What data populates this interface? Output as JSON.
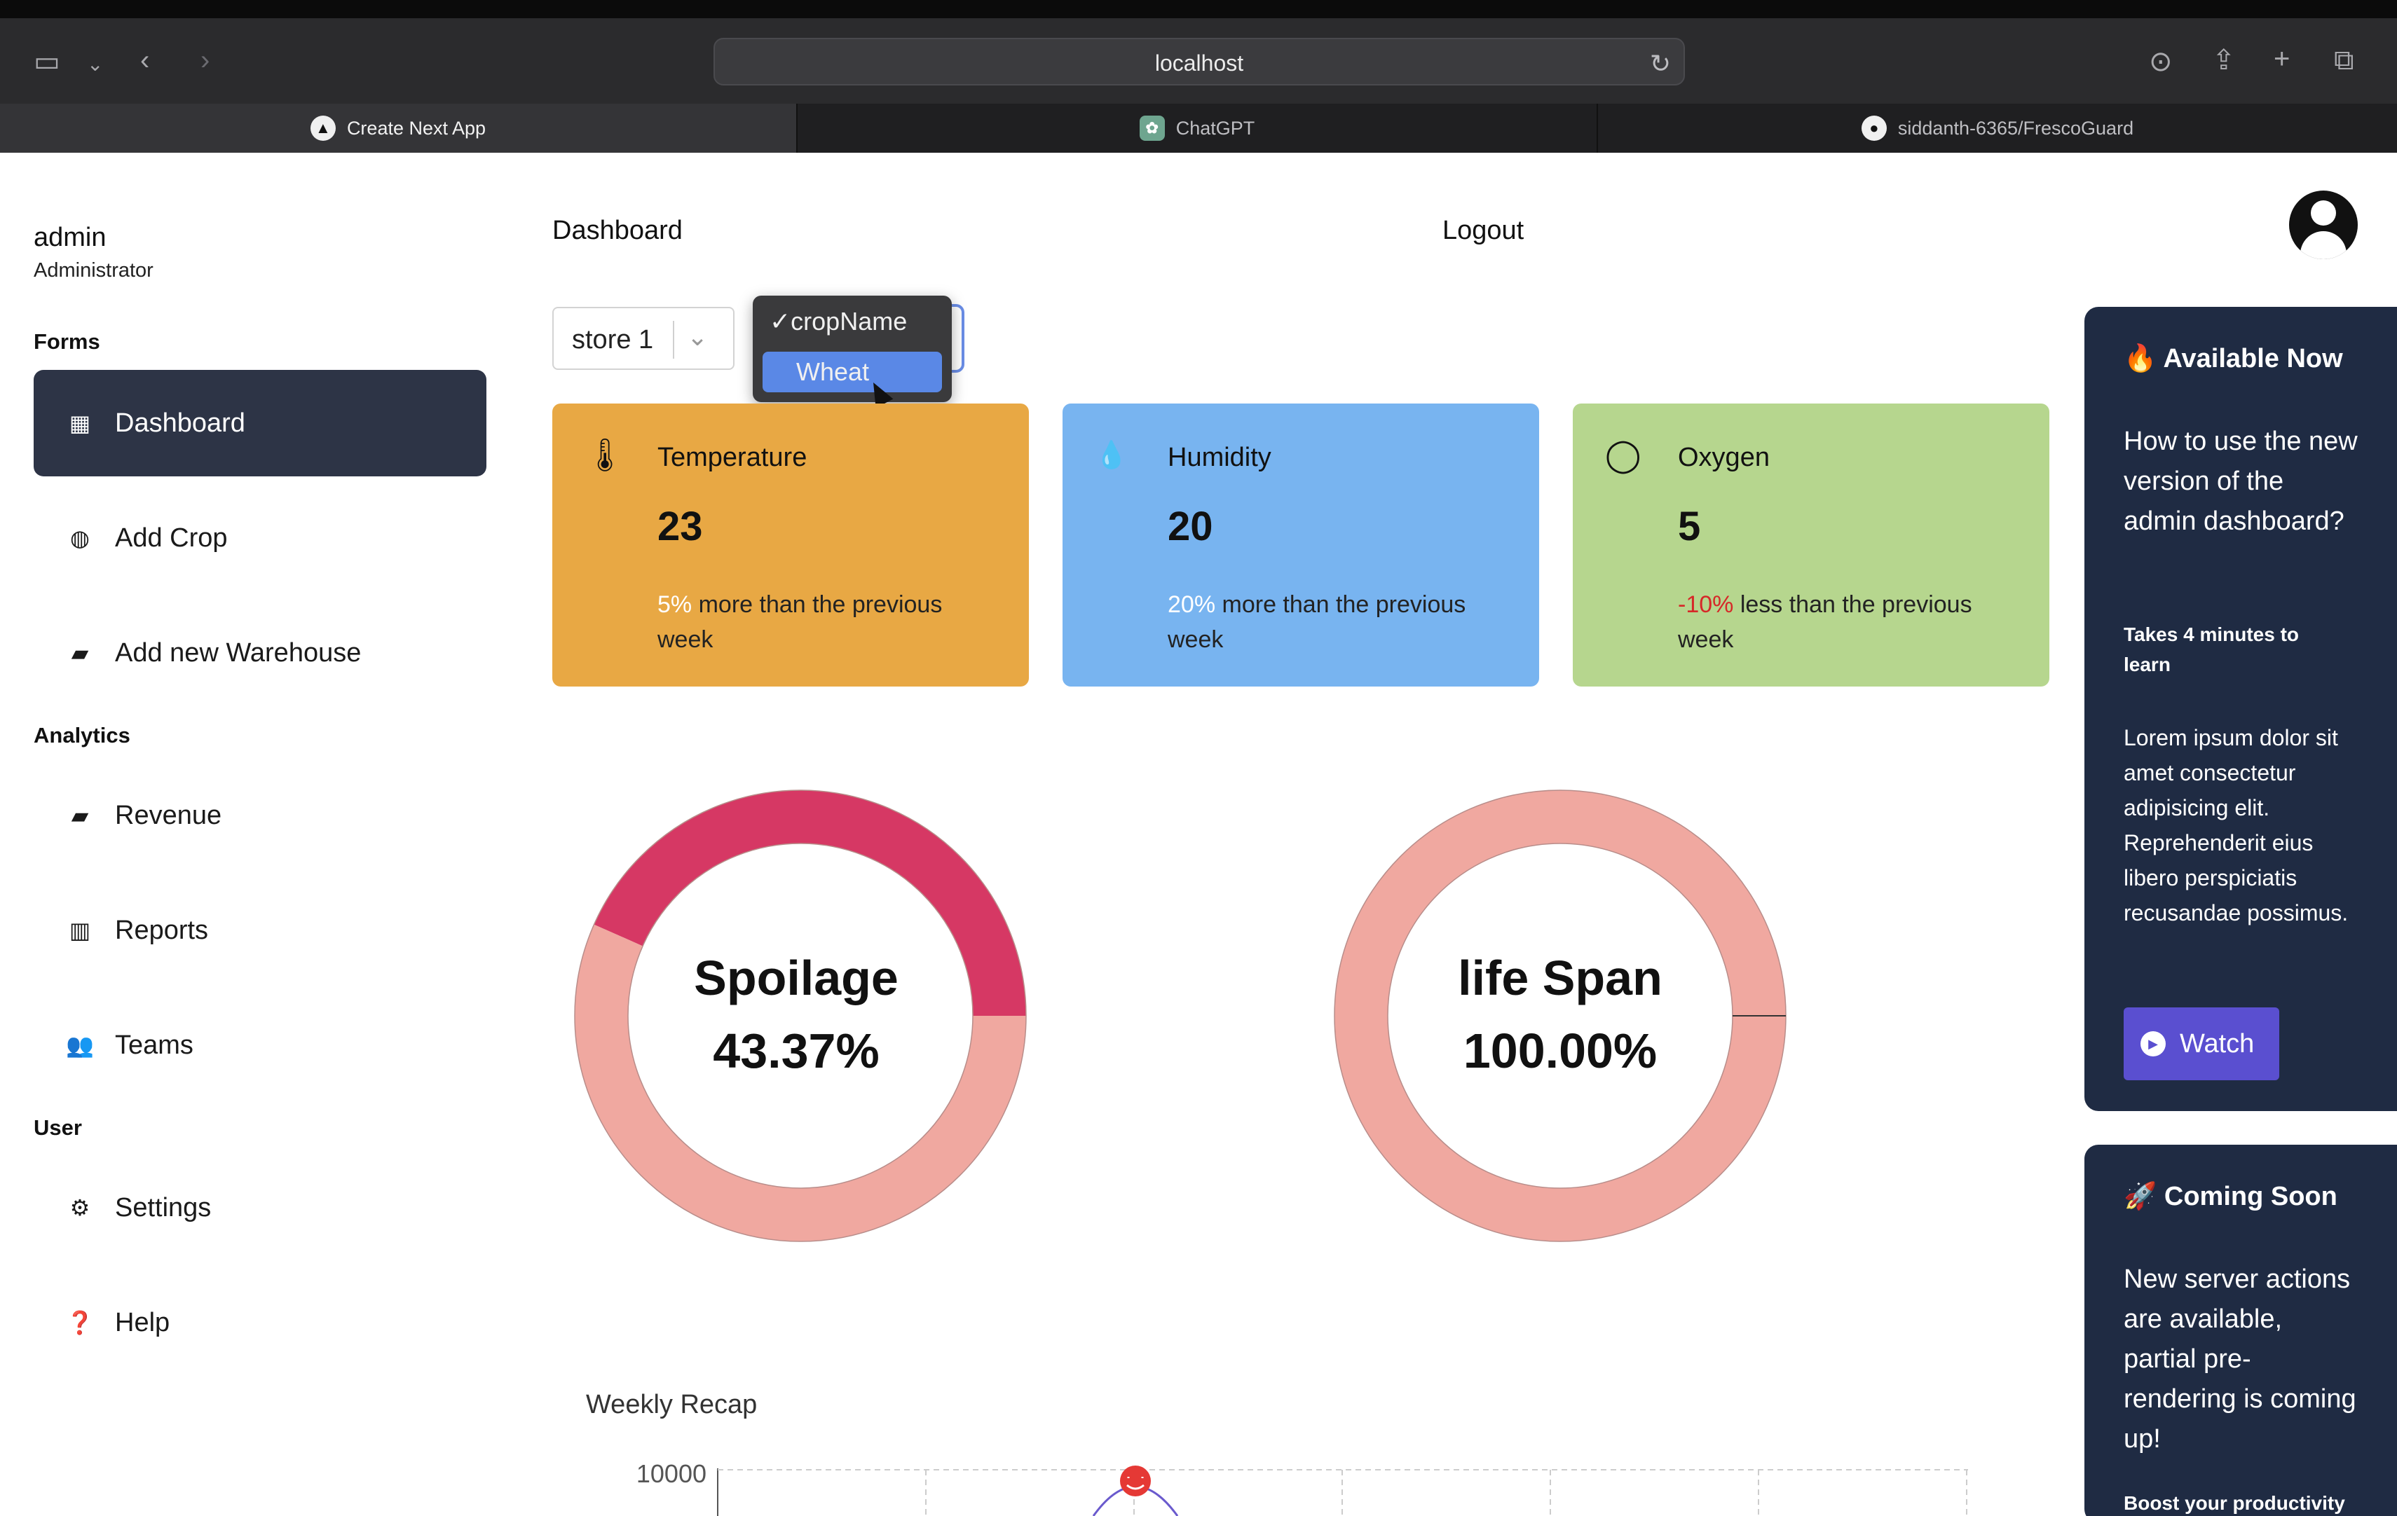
{
  "browser": {
    "url": "localhost",
    "tabs": [
      {
        "label": "Create Next App"
      },
      {
        "label": "ChatGPT"
      },
      {
        "label": "siddanth-6365/FrescoGuard"
      }
    ]
  },
  "sidebar": {
    "user_name": "admin",
    "user_role": "Administrator",
    "sections": {
      "forms": "Forms",
      "analytics": "Analytics",
      "user": "User"
    },
    "items": {
      "dashboard": "Dashboard",
      "add_crop": "Add Crop",
      "add_warehouse": "Add new Warehouse",
      "revenue": "Revenue",
      "reports": "Reports",
      "teams": "Teams",
      "settings": "Settings",
      "help": "Help"
    }
  },
  "header": {
    "dashboard": "Dashboard",
    "logout": "Logout"
  },
  "filters": {
    "store_value": "store 1",
    "crop_options": [
      {
        "label": "cropName",
        "checked": true
      },
      {
        "label": "Wheat",
        "highlighted": true
      }
    ]
  },
  "metrics": {
    "temperature": {
      "title": "Temperature",
      "value": "23",
      "pct": "5%",
      "desc": " more than the previous week"
    },
    "humidity": {
      "title": "Humidity",
      "value": "20",
      "pct": "20%",
      "desc": " more than the previous week"
    },
    "oxygen": {
      "title": "Oxygen",
      "value": "5",
      "pct": "-10%",
      "desc": " less than the previous week"
    }
  },
  "chart_data": [
    {
      "type": "pie",
      "title": "Spoilage",
      "value_label": "43.37%",
      "slices": [
        {
          "value": 43.37,
          "color": "#d63864"
        },
        {
          "value": 56.63,
          "color": "#f0a8a0"
        }
      ]
    },
    {
      "type": "pie",
      "title": "life Span",
      "value_label": "100.00%",
      "slices": [
        {
          "value": 100,
          "color": "#f0a8a0"
        },
        {
          "value": 0,
          "color": "#d63864"
        }
      ]
    },
    {
      "type": "line",
      "title": "Weekly Recap",
      "y_ticks": [
        "10000"
      ],
      "grid": true
    }
  ],
  "promos": {
    "available": {
      "title": "Available Now",
      "question": "How to use the new version of the admin dashboard?",
      "sub": "Takes 4 minutes to learn",
      "body": "Lorem ipsum dolor sit amet consectetur adipisicing elit. Reprehenderit eius libero perspiciatis recusandae possimus.",
      "button": "Watch"
    },
    "coming": {
      "title": "Coming Soon",
      "body": "New server actions are available, partial pre-rendering is coming up!",
      "footer": "Boost your productivity"
    }
  },
  "colors": {
    "temperature_card": "#e8a844",
    "humidity_card": "#78b4f0",
    "oxygen_card": "#b6d68e",
    "sidebar_active": "#2d3446",
    "promo_bg": "#1f2b43",
    "watch_button": "#5a4fd0"
  }
}
